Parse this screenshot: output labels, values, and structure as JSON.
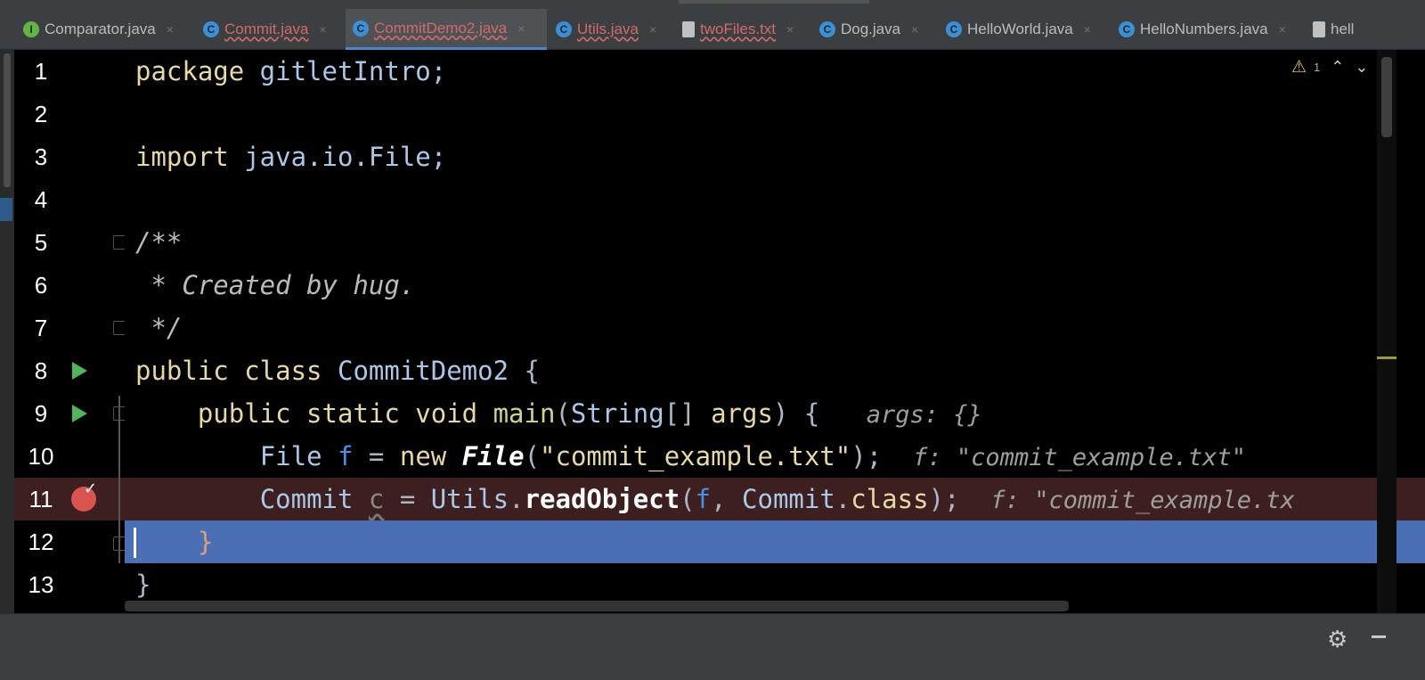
{
  "tabs": [
    {
      "label": "Comparator.java",
      "icon": "interface-icon",
      "state": "normal"
    },
    {
      "label": "Commit.java",
      "icon": "class-icon",
      "state": "error"
    },
    {
      "label": "CommitDemo2.java",
      "icon": "class-icon",
      "state": "active-error"
    },
    {
      "label": "Utils.java",
      "icon": "class-icon",
      "state": "error"
    },
    {
      "label": "twoFiles.txt",
      "icon": "text-file-icon",
      "state": "error"
    },
    {
      "label": "Dog.java",
      "icon": "class-icon",
      "state": "normal"
    },
    {
      "label": "HelloWorld.java",
      "icon": "class-icon",
      "state": "normal"
    },
    {
      "label": "HelloNumbers.java",
      "icon": "class-icon",
      "state": "normal"
    },
    {
      "label": "hell",
      "icon": "text-file-icon",
      "state": "normal"
    }
  ],
  "tab_close_glyph": "×",
  "inspections": {
    "warning_count": "1"
  },
  "editor": {
    "line_numbers": [
      "1",
      "2",
      "3",
      "4",
      "5",
      "6",
      "7",
      "8",
      "9",
      "10",
      "11",
      "12",
      "13"
    ],
    "l1": {
      "kw": "package",
      "rest": " gitletIntro;"
    },
    "l3": {
      "kw": "import",
      "rest": " java.io.File;"
    },
    "l5": {
      "text": "/**"
    },
    "l6": {
      "text": " * Created by hug."
    },
    "l7": {
      "text": " */"
    },
    "l8": {
      "kw": "public class",
      "name": "CommitDemo2",
      "rest": " {"
    },
    "l9": {
      "kw": "public static void",
      "fn": "main",
      "p1": "(",
      "type": "String",
      "p2": "[] ",
      "arg": "args",
      "p3": ") {",
      "hint": "args: {}"
    },
    "l10": {
      "type": "File",
      "var": "f",
      "eq": " = ",
      "kw": "new",
      "ctor": "File",
      "lp": "(",
      "str": "\"commit_example.txt\"",
      "rp": ");",
      "hint": "f: \"commit_example.txt\""
    },
    "l11": {
      "type": "Commit",
      "var": "c",
      "eq": " = ",
      "cls": "Utils",
      "dot": ".",
      "method": "readObject",
      "lp": "(",
      "arg": "f",
      "comma": ", ",
      "cls2": "Commit",
      "dot2": ".",
      "kw": "class",
      "rp": ");",
      "hint": "f: \"commit_example.tx"
    },
    "l12": {
      "text": "}"
    },
    "l13": {
      "text": "}"
    }
  },
  "colors": {
    "accent": "#4a88c7",
    "execution_line": "#4a6fb5",
    "breakpoint": "#d9534f",
    "run_gutter": "#4fb45a"
  }
}
